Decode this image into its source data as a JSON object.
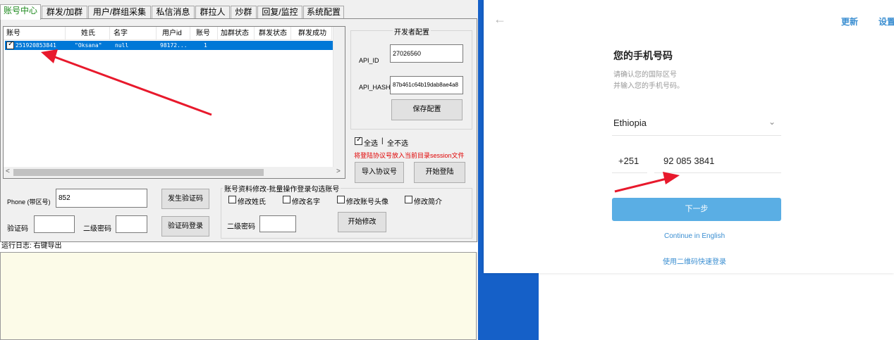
{
  "tabs": [
    "账号中心",
    "群发/加群",
    "用户/群组采集",
    "私信消息",
    "群拉人",
    "炒群",
    "回复/监控",
    "系统配置"
  ],
  "list": {
    "columns": [
      "账号",
      "姓氏",
      "名字",
      "用户id",
      "账号",
      "加群状态",
      "群发状态",
      "群发成功"
    ],
    "row": {
      "checked": true,
      "account": "251920853841",
      "surname": "\"Oksana\"",
      "name": "null",
      "userid": "98172...",
      "count": "1"
    }
  },
  "dev": {
    "title": "开发者配置",
    "api_id_label": "API_ID",
    "api_id": "27026560",
    "api_hash_label": "API_HASH",
    "api_hash": "87b461c64b19dab8ae4a8",
    "save_button": "保存配置"
  },
  "select": {
    "all_label": "全选",
    "all_checked": true,
    "separator": "|",
    "none_label": "全不选"
  },
  "hint": "将登陆协议号放入当前目录session文件",
  "import_button": "导入协议号",
  "login_button": "开始登陆",
  "phone": {
    "label": "Phone (带区号)",
    "value": "852",
    "send_code_button": "发生验证码"
  },
  "verify": {
    "code_label": "验证码",
    "pwd_label": "二级密码",
    "login_button": "验证码登录"
  },
  "edit": {
    "title": "账号资料修改-批量操作登录勾选账号",
    "checks": [
      "修改姓氏",
      "修改名字",
      "修改账号头像",
      "修改简介"
    ],
    "pwd_label": "二级密码",
    "start_button": "开始修改"
  },
  "log": {
    "label": "运行日志: 右键导出"
  },
  "telegram": {
    "back_icon": "arrow-left-icon",
    "update_link": "更新",
    "settings_link": "设置",
    "title": "您的手机号码",
    "subtitle_1": "请确认您的国际区号",
    "subtitle_2": "并输入您的手机号码。",
    "country": "Ethiopia",
    "code": "+251",
    "number": "92 085 3841",
    "next_button": "下一步",
    "english_link": "Continue in English",
    "qr_link": "使用二维码快速登录"
  },
  "colors": {
    "accent_red": "#e8192c",
    "tg_blue": "#5aaee4",
    "desktop_blue": "#1560c8",
    "active_tab": "#1e8a1e"
  }
}
